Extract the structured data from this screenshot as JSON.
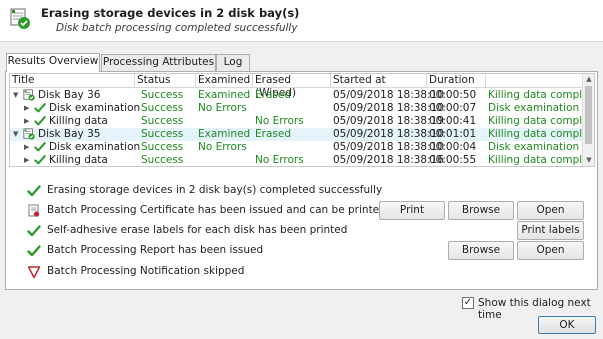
{
  "header": {
    "title": "Erasing storage devices in 2 disk bay(s)",
    "subtitle": "Disk batch processing completed successfully"
  },
  "tabs": [
    {
      "label": "Results Overview",
      "active": true
    },
    {
      "label": "Processing Attributes",
      "active": false
    },
    {
      "label": "Log",
      "active": false
    }
  ],
  "grid": {
    "columns": [
      "Title",
      "Status",
      "Examined",
      "Erased (Wiped)",
      "Started at",
      "Duration",
      ""
    ],
    "rows": [
      {
        "title": "Disk Bay 36",
        "level": 0,
        "expanded": true,
        "icon": "disk-bay-check-icon",
        "status": "Success",
        "examined": "Examined",
        "erased": "Erased",
        "started": "05/09/2018 18:38:10",
        "duration": "00:00:50",
        "info": "Killing data completed",
        "selected": false
      },
      {
        "title": "Disk examination",
        "level": 1,
        "expanded": false,
        "icon": "green-check-icon",
        "status": "Success",
        "examined": "No Errors",
        "erased": "",
        "started": "05/09/2018 18:38:10",
        "duration": "00:00:07",
        "info": "Disk examination comp",
        "selected": false
      },
      {
        "title": "Killing data",
        "level": 1,
        "expanded": false,
        "icon": "green-check-icon",
        "status": "Success",
        "examined": "",
        "erased": "No Errors",
        "started": "05/09/2018 18:38:19",
        "duration": "00:00:41",
        "info": "Killing data completed",
        "selected": false
      },
      {
        "title": "Disk Bay 35",
        "level": 0,
        "expanded": true,
        "icon": "disk-bay-check-icon",
        "status": "Success",
        "examined": "Examined",
        "erased": "Erased",
        "started": "05/09/2018 18:38:10",
        "duration": "00:01:01",
        "info": "Killing data completed",
        "selected": true
      },
      {
        "title": "Disk examination",
        "level": 1,
        "expanded": false,
        "icon": "green-check-icon",
        "status": "Success",
        "examined": "No Errors",
        "erased": "",
        "started": "05/09/2018 18:38:10",
        "duration": "00:00:04",
        "info": "Disk examination comp",
        "selected": false
      },
      {
        "title": "Killing data",
        "level": 1,
        "expanded": false,
        "icon": "green-check-icon",
        "status": "Success",
        "examined": "",
        "erased": "No Errors",
        "started": "05/09/2018 18:38:16",
        "duration": "00:00:55",
        "info": "Killing data completed",
        "selected": false
      }
    ]
  },
  "results": [
    {
      "icon": "green-check-icon",
      "text": "Erasing storage devices in 2 disk bay(s) completed successfully",
      "buttons": []
    },
    {
      "icon": "certificate-icon",
      "text": "Batch Processing Certificate has been issued and can be printed",
      "buttons": [
        "Print",
        "Browse",
        "Open"
      ]
    },
    {
      "icon": "green-check-icon",
      "text": "Self-adhesive erase labels for each disk has been printed",
      "buttons": [
        "Print labels"
      ]
    },
    {
      "icon": "green-check-icon",
      "text": "Batch Processing Report has been issued",
      "buttons": [
        "Browse",
        "Open"
      ]
    },
    {
      "icon": "red-triangle-icon",
      "text": "Batch Processing Notification skipped",
      "buttons": []
    }
  ],
  "footer": {
    "show_dialog_label": "Show this dialog next time",
    "show_dialog_checked": true,
    "ok_label": "OK"
  },
  "colors": {
    "success_green": "#1f8a1f",
    "selection": "#e5f3fb",
    "warning_red": "#c0282d"
  }
}
